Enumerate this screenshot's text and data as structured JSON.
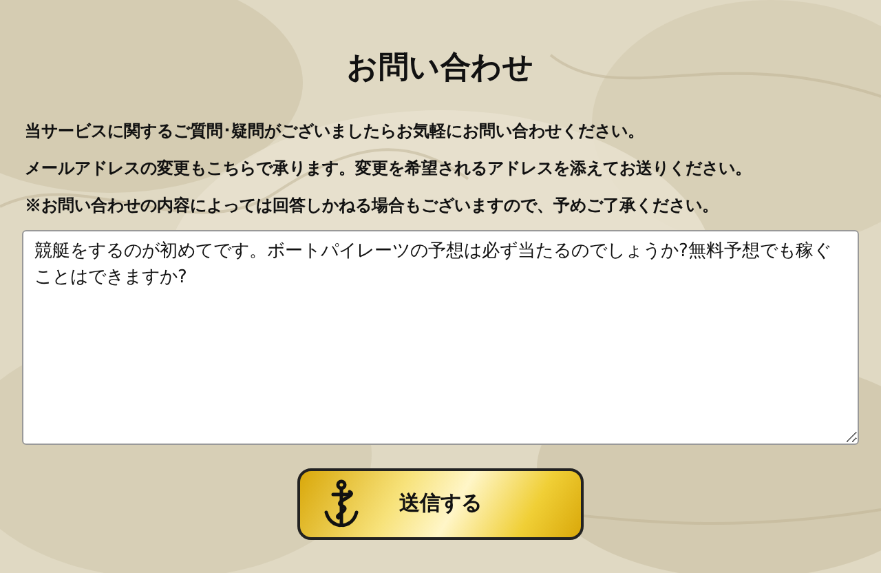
{
  "title": "お問い合わせ",
  "notes": [
    "当サービスに関するご質問･疑問がございましたらお気軽にお問い合わせください。",
    "メールアドレスの変更もこちらで承ります。変更を希望されるアドレスを添えてお送りください。",
    "※お問い合わせの内容によっては回答しかねる場合もございますので、予めご了承ください。"
  ],
  "message": {
    "value": "競艇をするのが初めてです。ボートパイレーツの予想は必ず当たるのでしょうか?無料予想でも稼ぐことはできますか?"
  },
  "submit": {
    "label": "送信する"
  }
}
